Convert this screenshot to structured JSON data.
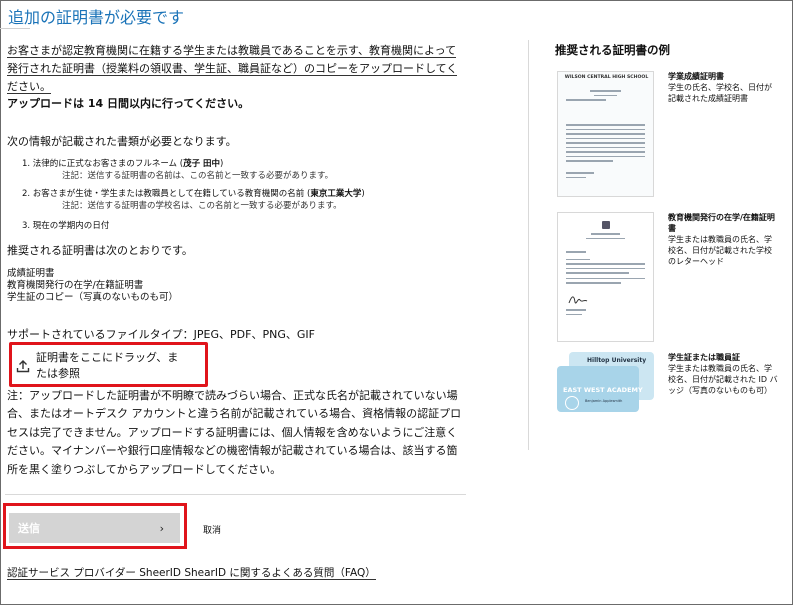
{
  "page": {
    "title": "追加の証明書が必要です",
    "intro": "お客さまが認定教育機関に在籍する学生または教職員であることを示す、教育機関によって発行された証明書（授業料の領収書、学生証、職員証など）のコピーをアップロードしてください。",
    "deadline": "アップロードは 14 日間以内に行ってください。",
    "required_heading": "次の情報が記載された書類が必要となります。",
    "requirements": [
      {
        "prefix": "1. 法律的に正式なお客さまのフルネーム (",
        "value": "茂子 田中",
        "suffix": ")",
        "note": "注記：送信する証明書の名前は、この名前と一致する必要があります。"
      },
      {
        "prefix": "2. お客さまが生徒・学生または教職員として在籍している教育機関の名前 (",
        "value": "東京工業大学",
        "suffix": ")",
        "note": "注記：送信する証明書の学校名は、この名前と一致する必要があります。"
      },
      {
        "prefix": "3. 現在の学期内の日付",
        "value": "",
        "suffix": "",
        "note": ""
      }
    ],
    "recommended_heading": "推奨される証明書は次のとおりです。",
    "recommended_docs": [
      "成績証明書",
      "教育機関発行の在学/在籍証明書",
      "学生証のコピー（写真のないものも可）"
    ],
    "filetypes": "サポートされているファイルタイプ：JPEG、PDF、PNG、GIF",
    "upload_label": "証明書をここにドラッグ、または参照",
    "warning": "注：アップロードした証明書が不明瞭で読みづらい場合、正式な氏名が記載されていない場合、またはオートデスク アカウントと違う名前が記載されている場合、資格情報の認証プロセスは完了できません。アップロードする証明書には、個人情報を含めないようにご注意ください。マイナンバーや銀行口座情報などの機密情報が記載されている場合は、該当する箇所を黒く塗りつぶしてからアップロードしてください。",
    "submit_label": "送信",
    "submit_chevron": "›",
    "cancel_label": "取消",
    "faq_link": "認証サービス プロバイダー SheerID ShearID に関するよくある質問（FAQ）"
  },
  "examples": {
    "heading": "推奨される証明書の例",
    "items": [
      {
        "title": "学業成績証明書",
        "desc": "学生の氏名、学校名、日付が記載された成績証明書",
        "thumb_text": "WILSON CENTRAL HIGH SCHOOL"
      },
      {
        "title": "教育機関発行の在学/在籍証明書",
        "desc": "学生または教職員の氏名、学校名、日付が記載された学校のレターヘッド",
        "thumb_text": ""
      },
      {
        "title": "学生証または職員証",
        "desc": "学生または教職員の氏名、学校名、日付が記載された ID バッジ（写真のないものも可）",
        "card_back": "Hilltop University",
        "card_front": "EAST WEST ACADEMY",
        "card_name": "Benjamin Applesmith"
      }
    ]
  },
  "colors": {
    "title": "#1a73b8",
    "highlight": "#e0141b",
    "submit_bg": "#d4d4d4"
  },
  "icons": {
    "upload": "upload-icon",
    "chevron": "chevron-right-icon"
  }
}
